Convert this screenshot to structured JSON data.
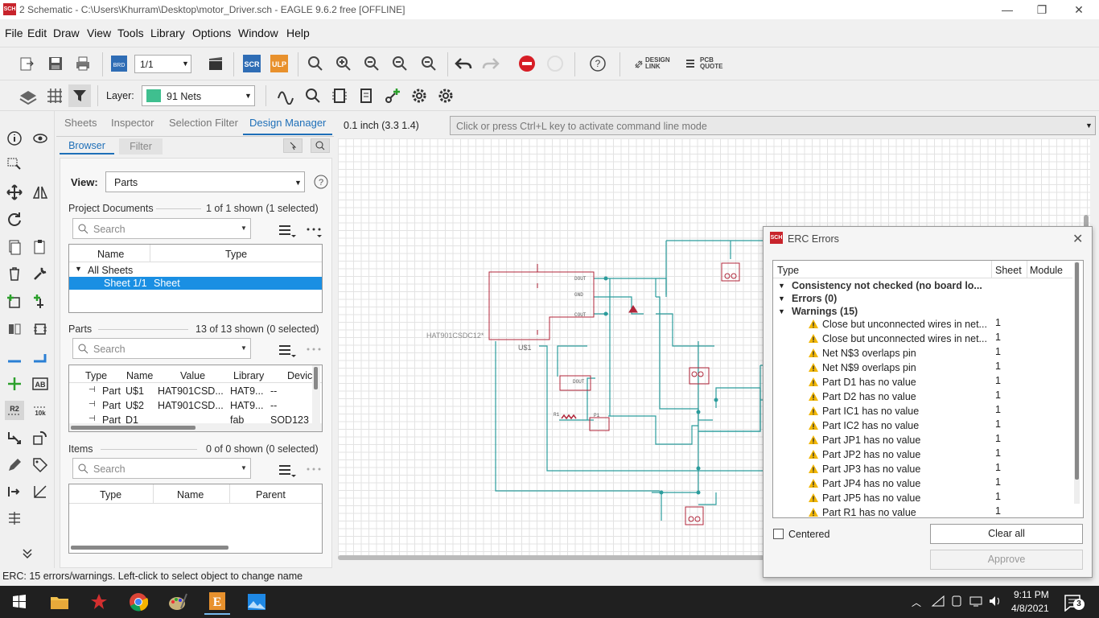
{
  "window": {
    "icon_text": "SCH",
    "title": "2 Schematic - C:\\Users\\Khurram\\Desktop\\motor_Driver.sch - EAGLE 9.6.2 free [OFFLINE]",
    "minimize": "—",
    "restore": "❐",
    "close": "✕"
  },
  "menu": [
    "File",
    "Edit",
    "Draw",
    "View",
    "Tools",
    "Library",
    "Options",
    "Window",
    "Help"
  ],
  "toolbar": {
    "sheet_select": "1/1",
    "brd_label": "BRD",
    "scr_label": "SCR",
    "ulp_label": "ULP",
    "design_link": "DESIGN\nLINK",
    "pcb_quote": "PCB\nQUOTE"
  },
  "layer_bar": {
    "label": "Layer:",
    "layer_value": "91 Nets",
    "layer_color": "#3fbf8f"
  },
  "panel": {
    "tabs": [
      "Sheets",
      "Inspector",
      "Selection Filter",
      "Design Manager"
    ],
    "active_tab": "Design Manager",
    "subtabs": [
      "Browser",
      "Filter"
    ],
    "view_label": "View:",
    "view_value": "Parts",
    "project_documents": {
      "title": "Project Documents",
      "count": "1 of 1 shown (1 selected)",
      "search_placeholder": "Search",
      "columns": [
        "Name",
        "Type"
      ],
      "rows": [
        {
          "name": "All Sheets",
          "type": ""
        },
        {
          "name": "Sheet 1/1",
          "type": "Sheet"
        }
      ]
    },
    "parts": {
      "title": "Parts",
      "count": "13 of 13 shown (0 selected)",
      "search_placeholder": "Search",
      "columns": [
        "Type",
        "Name",
        "Value",
        "Library",
        "Devic"
      ],
      "rows": [
        {
          "type": "Part",
          "name": "U$1",
          "value": "HAT901CSD...",
          "library": "HAT9...",
          "device": "--"
        },
        {
          "type": "Part",
          "name": "U$2",
          "value": "HAT901CSD...",
          "library": "HAT9...",
          "device": "--"
        },
        {
          "type": "Part",
          "name": "D1",
          "value": "",
          "library": "fab",
          "device": "SOD123"
        }
      ]
    },
    "items": {
      "title": "Items",
      "count": "0 of 0 shown (0 selected)",
      "search_placeholder": "Search",
      "columns": [
        "Type",
        "Name",
        "Parent"
      ]
    }
  },
  "canvas": {
    "grid_info": "0.1 inch (3.3 1.4)",
    "command_placeholder": "Click or press Ctrl+L key to activate command line mode",
    "labels": {
      "u1_value": "HAT901CSDC12*",
      "u1_name": "U$1"
    }
  },
  "erc": {
    "title": "ERC Errors",
    "columns": [
      "Type",
      "Sheet",
      "Module"
    ],
    "groups": [
      {
        "label": "Consistency not checked (no board lo...",
        "bold": true
      },
      {
        "label": "Errors (0)",
        "bold": true
      },
      {
        "label": "Warnings (15)",
        "bold": true
      }
    ],
    "warnings": [
      {
        "text": "Close but unconnected wires in net...",
        "sheet": "1"
      },
      {
        "text": "Close but unconnected wires in net...",
        "sheet": "1"
      },
      {
        "text": "Net N$3 overlaps pin",
        "sheet": "1"
      },
      {
        "text": "Net N$9 overlaps pin",
        "sheet": "1"
      },
      {
        "text": "Part D1 has no value",
        "sheet": "1"
      },
      {
        "text": "Part D2 has no value",
        "sheet": "1"
      },
      {
        "text": "Part IC1 has no value",
        "sheet": "1"
      },
      {
        "text": "Part IC2 has no value",
        "sheet": "1"
      },
      {
        "text": "Part JP1 has no value",
        "sheet": "1"
      },
      {
        "text": "Part JP2 has no value",
        "sheet": "1"
      },
      {
        "text": "Part JP3 has no value",
        "sheet": "1"
      },
      {
        "text": "Part JP4 has no value",
        "sheet": "1"
      },
      {
        "text": "Part JP5 has no value",
        "sheet": "1"
      },
      {
        "text": "Part R1 has no value",
        "sheet": "1"
      }
    ],
    "centered_label": "Centered",
    "clear_all": "Clear all",
    "approve": "Approve"
  },
  "status": {
    "text": "ERC: 15 errors/warnings. Left-click to select object to change name"
  },
  "taskbar": {
    "time": "9:11 PM",
    "date": "4/8/2021",
    "notifications": "3"
  }
}
